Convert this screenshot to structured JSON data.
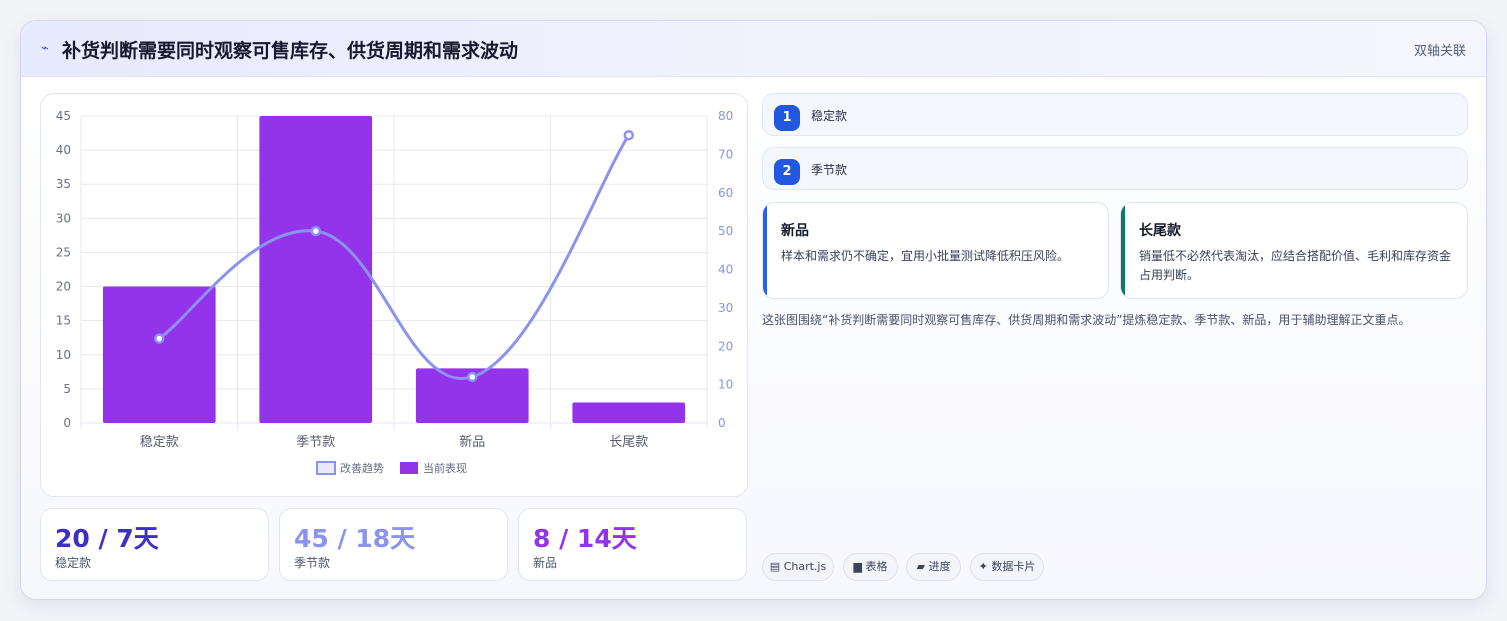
{
  "header": {
    "icon": "trend-line-icon",
    "title": "补货判断需要同时观察可售库存、供货周期和需求波动",
    "tag": "双轴关联"
  },
  "chart_data": {
    "type": "bar",
    "categories": [
      "稳定款",
      "季节款",
      "新品",
      "长尾款"
    ],
    "series": [
      {
        "name": "当前表现",
        "type": "bar",
        "axis": "left",
        "color": "#9333ea",
        "values": [
          20,
          45,
          8,
          3
        ]
      },
      {
        "name": "改善趋势",
        "type": "line",
        "axis": "right",
        "color": "#8b93ee",
        "values": [
          22,
          50,
          12,
          75
        ]
      }
    ],
    "ylim": [
      0,
      45
    ],
    "yticks": [
      0,
      5,
      10,
      15,
      20,
      25,
      30,
      35,
      40,
      45
    ],
    "y2lim": [
      0,
      80
    ],
    "y2ticks": [
      0,
      10,
      20,
      30,
      40,
      50,
      60,
      70,
      80
    ],
    "legend": [
      "改善趋势",
      "当前表现"
    ],
    "legend_position": "bottom",
    "grid": true
  },
  "stats": [
    {
      "value": "20 / 7天",
      "label": "稳定款",
      "color": "#3d2fc7"
    },
    {
      "value": "45 / 18天",
      "label": "季节款",
      "color": "#8b93ee"
    },
    {
      "value": "8 / 14天",
      "label": "新品",
      "color": "#9333ea"
    }
  ],
  "list": [
    {
      "number": "1",
      "label": "稳定款"
    },
    {
      "number": "2",
      "label": "季节款"
    }
  ],
  "notes": [
    {
      "title": "新品",
      "body": "样本和需求仍不确定，宜用小批量测试降低积压风险。",
      "accent": "#2563eb"
    },
    {
      "title": "长尾款",
      "body": "销量低不必然代表淘汰，应结合搭配价值、毛利和库存资金占用判断。",
      "accent": "#0f766e"
    }
  ],
  "summary": "这张图围绕“补货判断需要同时观察可售库存、供货周期和需求波动”提炼稳定款、季节款、新品，用于辅助理解正文重点。",
  "tags": [
    {
      "icon": "chart-icon",
      "glyph": "▤",
      "label": "Chart.js"
    },
    {
      "icon": "table-icon",
      "glyph": "▆",
      "label": "表格"
    },
    {
      "icon": "progress-icon",
      "glyph": "▰",
      "label": "进度"
    },
    {
      "icon": "sparkle-icon",
      "glyph": "✦",
      "label": "数据卡片"
    }
  ]
}
